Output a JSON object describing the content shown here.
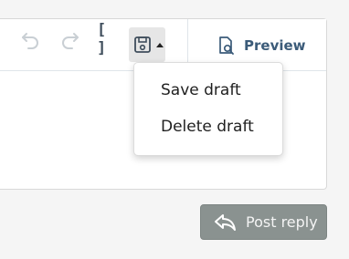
{
  "toolbar": {
    "undo_icon": "undo-icon",
    "redo_icon": "redo-icon",
    "brackets_label": "[ ]",
    "drafts_icon": "floppy-disk-icon",
    "preview_icon": "document-search-icon",
    "preview_label": "Preview"
  },
  "drafts_menu": {
    "items": [
      {
        "label": "Save draft"
      },
      {
        "label": "Delete draft"
      }
    ]
  },
  "actions": {
    "post_reply_icon": "reply-arrow-icon",
    "post_reply_label": "Post reply"
  },
  "colors": {
    "accent": "#3b5b79",
    "button_bg": "#8a9290",
    "disabled_icon": "#c9cfd4"
  }
}
